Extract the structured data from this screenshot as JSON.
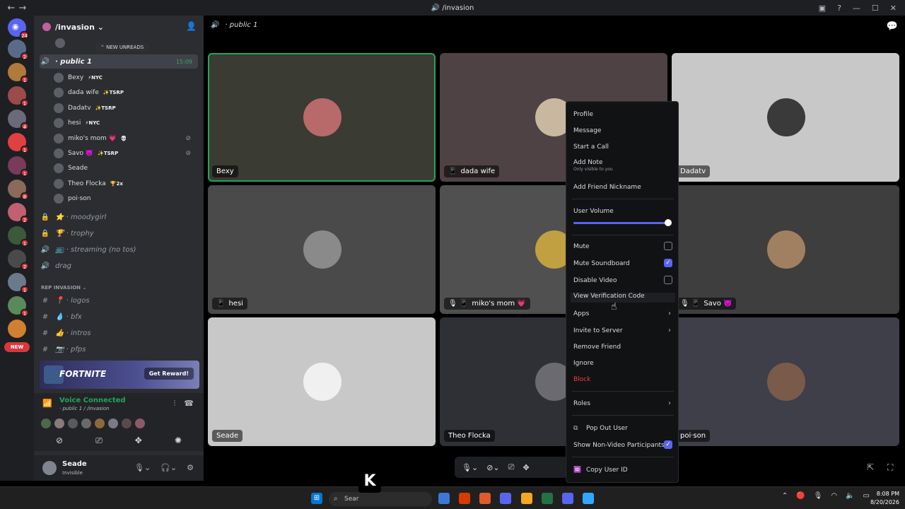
{
  "titlebar": {
    "title": "/invasion",
    "back": "←",
    "forward": "→"
  },
  "rail": {
    "home_badge": "24",
    "new_label": "NEW",
    "servers": [
      {
        "color": "#5a6b8a",
        "badge": "2"
      },
      {
        "color": "#b07a3a",
        "badge": "1"
      },
      {
        "color": "#9c4a4a",
        "badge": "1"
      },
      {
        "color": "#6a6a7a",
        "badge": "4"
      },
      {
        "color": "#e04040",
        "badge": "1"
      },
      {
        "color": "#7a3a5a",
        "badge": "1"
      },
      {
        "color": "#8a6a5a",
        "badge": "8"
      },
      {
        "color": "#c06070",
        "badge": "2"
      },
      {
        "color": "#3a5a3a",
        "badge": "1"
      },
      {
        "color": "#4a4a4a",
        "badge": "2"
      },
      {
        "color": "#6a7a8a",
        "badge": "1"
      },
      {
        "color": "#5a8a5a",
        "badge": "1"
      },
      {
        "color": "#d08030",
        "badge": ""
      }
    ]
  },
  "sidebar": {
    "server_name": "/invasion ⌄",
    "new_unreads": "NEW UNREADS",
    "active_channel": {
      "name": "· public 1",
      "time": "15:09"
    },
    "voice_users": [
      {
        "name": "Bexy",
        "tag": "⚡NYC",
        "muted": false
      },
      {
        "name": "dada wife",
        "tag": "✨TSRP",
        "muted": false
      },
      {
        "name": "Dadatv",
        "tag": "✨TSRP",
        "muted": false
      },
      {
        "name": "hesi",
        "tag": "⚡NYC",
        "muted": false
      },
      {
        "name": "miko's mom 💗",
        "tag": "💀",
        "muted": true
      },
      {
        "name": "Savo 👿",
        "tag": "✨TSRP",
        "muted": true
      },
      {
        "name": "Seade",
        "tag": "",
        "muted": false
      },
      {
        "name": "Theo Flocka",
        "tag": "🏆2x",
        "muted": false
      },
      {
        "name": "poi·son",
        "tag": "",
        "muted": false
      }
    ],
    "channels": [
      {
        "icon": "🔒",
        "name": "⭐ · moodygirl"
      },
      {
        "icon": "🔒",
        "name": "🏆 · trophy"
      },
      {
        "icon": "🔊",
        "name": "📺 · streaming (no tos)"
      },
      {
        "icon": "🔊",
        "name": "drag"
      }
    ],
    "category": "REP INVASION ⌄",
    "text_channels": [
      {
        "icon": "#",
        "name": "📍 · logos"
      },
      {
        "icon": "#",
        "name": "💧 · bfx"
      },
      {
        "icon": "#",
        "name": "👍 · intros"
      },
      {
        "icon": "#",
        "name": "📷 · pfps"
      }
    ]
  },
  "promo": {
    "name": "FORTNITE",
    "button": "Get Reward!"
  },
  "voice": {
    "status": "Voice Connected",
    "location": "· public 1 / /invasion",
    "avatar_colors": [
      "#4a6a4a",
      "#8a7a7a",
      "#5a5a5a",
      "#6a6a6a",
      "#8a6a3a",
      "#7a7a8a",
      "#5a4a4a",
      "#8a5a6a"
    ]
  },
  "user": {
    "name": "Seade",
    "status": "Invisible"
  },
  "stage": {
    "channel": "· public 1",
    "tiles": [
      {
        "label": "Bexy",
        "bg": "#3a3b33",
        "pic": "#b86a6a",
        "speaking": true,
        "icons": ""
      },
      {
        "label": "dada wife",
        "bg": "#4e4244",
        "pic": "#c8b8a0",
        "speaking": false,
        "icons": "📱"
      },
      {
        "label": "Dadatv",
        "bg": "#c8c8c8",
        "pic": "#3a3a3a",
        "speaking": false,
        "icons": ""
      },
      {
        "label": "hesi",
        "bg": "#4a4a4a",
        "pic": "#8a8a8a",
        "speaking": false,
        "icons": "📱"
      },
      {
        "label": "miko's mom 💗",
        "bg": "#505050",
        "pic": "#c0a040",
        "speaking": false,
        "icons": "🎙 📱"
      },
      {
        "label": "Savo 👿",
        "bg": "#3e3e3e",
        "pic": "#a08060",
        "speaking": false,
        "icons": "🎙 📱"
      },
      {
        "label": "Seade",
        "bg": "#c8c8c8",
        "pic": "#f0f0f0",
        "speaking": false,
        "icons": ""
      },
      {
        "label": "Theo Flocka",
        "bg": "#2e3036",
        "pic": "#6a6a70",
        "speaking": false,
        "icons": ""
      },
      {
        "label": "poi·son",
        "bg": "#3e3f48",
        "pic": "#7a5a4a",
        "speaking": false,
        "icons": ""
      }
    ]
  },
  "context_menu": {
    "profile": "Profile",
    "message": "Message",
    "start_call": "Start a Call",
    "add_note": "Add Note",
    "add_note_sub": "Only visible to you",
    "add_nickname": "Add Friend Nickname",
    "user_volume": "User Volume",
    "volume_percent": 100,
    "mute": "Mute",
    "mute_checked": false,
    "mute_soundboard": "Mute Soundboard",
    "mute_soundboard_checked": true,
    "disable_video": "Disable Video",
    "disable_video_checked": false,
    "view_verification": "View Verification Code",
    "apps": "Apps",
    "invite": "Invite to Server",
    "remove_friend": "Remove Friend",
    "ignore": "Ignore",
    "block": "Block",
    "roles": "Roles",
    "pop_out": "Pop Out User",
    "show_non_video": "Show Non-Video Participants",
    "show_non_video_checked": true,
    "copy_id": "Copy User ID"
  },
  "taskbar": {
    "search_placeholder": "Sear",
    "time": "8:08 PM",
    "date": "8/20/2026",
    "app_colors": [
      "#3c78d8",
      "#d83b01",
      "#e05a2a",
      "#5865f2",
      "#f5a623",
      "#217346",
      "#5865f2",
      "#31a8ff"
    ]
  }
}
